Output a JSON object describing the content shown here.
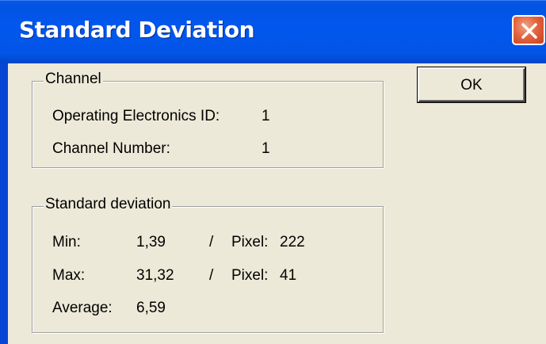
{
  "window": {
    "title": "Standard Deviation"
  },
  "buttons": {
    "ok_label": "OK"
  },
  "icons": {
    "close": "close-icon"
  },
  "colors": {
    "titlebar": "#0156ee",
    "close_button": "#e3653f",
    "dialog_background": "#ece9d8"
  },
  "channel_group": {
    "legend": "Channel",
    "operating_electronics_id_label": "Operating Electronics ID:",
    "operating_electronics_id_value": "1",
    "channel_number_label": "Channel Number:",
    "channel_number_value": "1"
  },
  "stddev_group": {
    "legend": "Standard deviation",
    "min_label": "Min:",
    "min_value": "1,39",
    "min_separator": "/",
    "min_pixel_label": "Pixel:",
    "min_pixel_value": "222",
    "max_label": "Max:",
    "max_value": "31,32",
    "max_separator": "/",
    "max_pixel_label": "Pixel:",
    "max_pixel_value": "41",
    "average_label": "Average:",
    "average_value": "6,59"
  }
}
